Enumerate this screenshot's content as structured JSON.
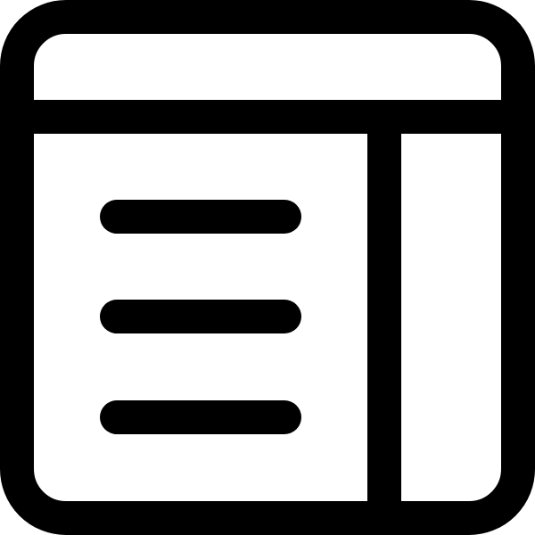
{
  "icon": {
    "name": "layout-sidebar-right-text-icon",
    "stroke_color": "#000000",
    "fill_color": "#ffffff",
    "content_line_count": 3
  }
}
